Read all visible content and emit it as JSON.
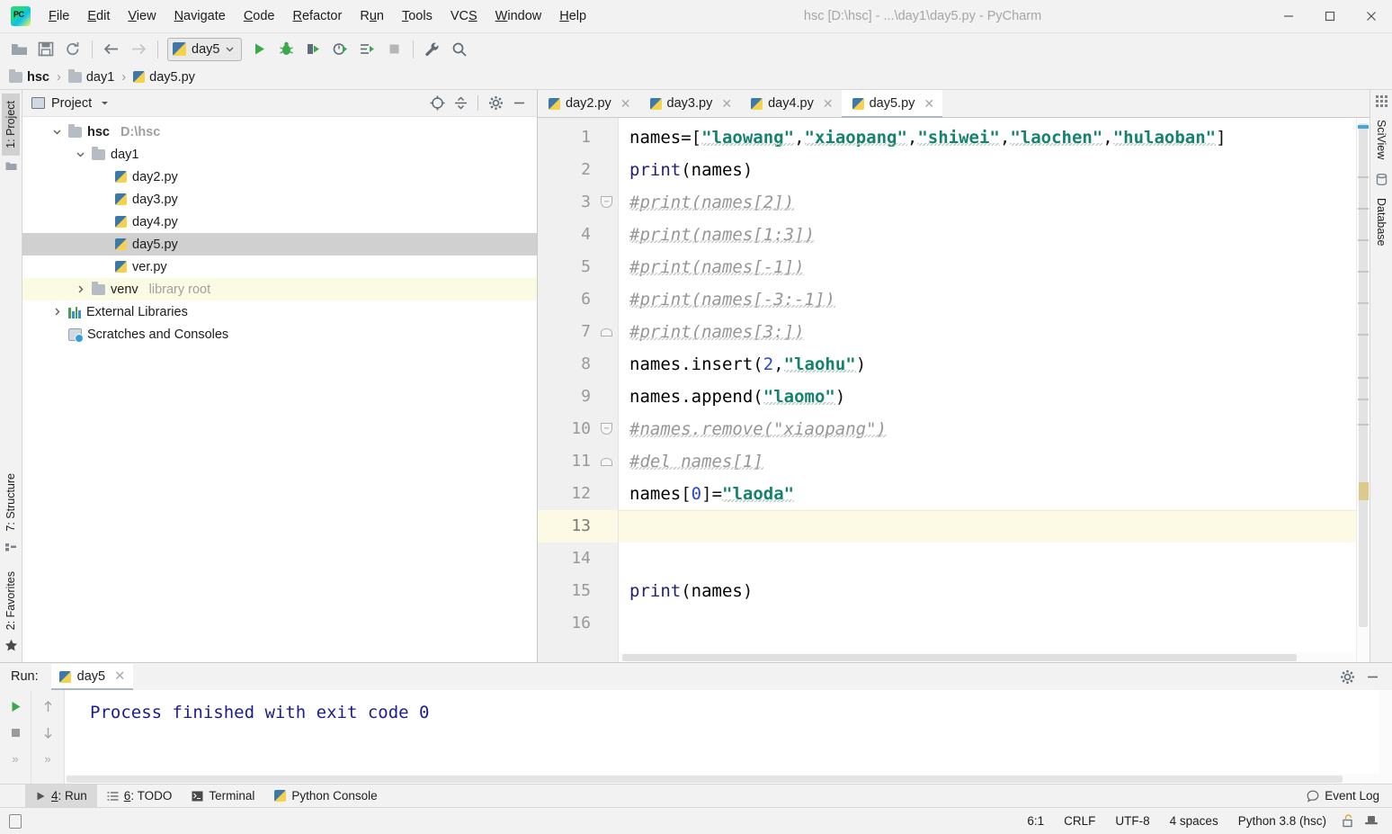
{
  "window": {
    "title": "hsc [D:\\hsc] - ...\\day1\\day5.py - PyCharm",
    "minimize": "—",
    "maximize": "▢",
    "close": "✕"
  },
  "menu": [
    {
      "label": "File"
    },
    {
      "label": "Edit"
    },
    {
      "label": "View"
    },
    {
      "label": "Navigate"
    },
    {
      "label": "Code"
    },
    {
      "label": "Refactor"
    },
    {
      "label": "Run"
    },
    {
      "label": "Tools"
    },
    {
      "label": "VCS"
    },
    {
      "label": "Window"
    },
    {
      "label": "Help"
    }
  ],
  "toolbar": {
    "open_icon": "open-folder-icon",
    "save_icon": "save-icon",
    "sync_icon": "refresh-icon",
    "back_icon": "back-arrow-icon",
    "forward_icon": "forward-arrow-icon",
    "run_config": "day5",
    "run_icon": "run-icon",
    "debug_icon": "debug-icon",
    "run_coverage_icon": "run-with-coverage-icon",
    "profile_icon": "profile-icon",
    "run_tests_icon": "run-tests-icon",
    "stop_icon": "stop-icon",
    "settings_icon": "wrench-icon",
    "search_icon": "search-icon"
  },
  "breadcrumb": [
    {
      "label": "hsc",
      "icon": "folder-icon",
      "bold": true
    },
    {
      "label": "day1",
      "icon": "folder-icon",
      "bold": false
    },
    {
      "label": "day5.py",
      "icon": "python-file-icon",
      "bold": false
    }
  ],
  "left_strip": {
    "project": "1: Project",
    "structure": "7: Structure",
    "favorites": "2: Favorites"
  },
  "right_strip": {
    "sciview": "SciView",
    "database": "Database"
  },
  "project_panel": {
    "title": "Project",
    "dropdown_icon": "chevron-down-icon",
    "locate_icon": "locate-file-icon",
    "collapse_icon": "collapse-all-icon",
    "settings_icon": "gear-icon",
    "hide_icon": "minimize-icon",
    "tree": [
      {
        "label": "hsc",
        "sub": "D:\\hsc",
        "indent": 0,
        "twisty": "expanded",
        "icon": "folder-icon",
        "bold": true,
        "state": "normal"
      },
      {
        "label": "day1",
        "sub": "",
        "indent": 1,
        "twisty": "expanded",
        "icon": "folder-icon",
        "bold": false,
        "state": "normal"
      },
      {
        "label": "day2.py",
        "sub": "",
        "indent": 2,
        "twisty": "none",
        "icon": "python-file-icon",
        "bold": false,
        "state": "normal"
      },
      {
        "label": "day3.py",
        "sub": "",
        "indent": 2,
        "twisty": "none",
        "icon": "python-file-icon",
        "bold": false,
        "state": "normal"
      },
      {
        "label": "day4.py",
        "sub": "",
        "indent": 2,
        "twisty": "none",
        "icon": "python-file-icon",
        "bold": false,
        "state": "normal"
      },
      {
        "label": "day5.py",
        "sub": "",
        "indent": 2,
        "twisty": "none",
        "icon": "python-file-icon",
        "bold": false,
        "state": "selected"
      },
      {
        "label": "ver.py",
        "sub": "",
        "indent": 2,
        "twisty": "none",
        "icon": "python-file-icon",
        "bold": false,
        "state": "normal"
      },
      {
        "label": "venv",
        "sub": "library root",
        "indent": 1,
        "twisty": "collapsed",
        "icon": "folder-icon",
        "bold": false,
        "state": "highlight"
      },
      {
        "label": "External Libraries",
        "sub": "",
        "indent": 0,
        "twisty": "collapsed",
        "icon": "libraries-icon",
        "bold": false,
        "state": "normal"
      },
      {
        "label": "Scratches and Consoles",
        "sub": "",
        "indent": 0,
        "twisty": "none",
        "icon": "scratches-icon",
        "bold": false,
        "state": "normal"
      }
    ]
  },
  "editor": {
    "tabs": [
      {
        "label": "day2.py",
        "active": false,
        "icon": "python-file-icon",
        "close": "✕"
      },
      {
        "label": "day3.py",
        "active": false,
        "icon": "python-file-icon",
        "close": "✕"
      },
      {
        "label": "day4.py",
        "active": false,
        "icon": "python-file-icon",
        "close": "✕"
      },
      {
        "label": "day5.py",
        "active": true,
        "icon": "python-file-icon",
        "close": "✕"
      }
    ],
    "line_numbers": [
      "1",
      "2",
      "3",
      "4",
      "5",
      "6",
      "7",
      "8",
      "9",
      "10",
      "11",
      "12",
      "13",
      "14",
      "15",
      "16"
    ],
    "current_line": 13,
    "lines": [
      {
        "n": 1,
        "text": "names=[\"laowang\",\"xiaopang\",\"shiwei\",\"laochen\",\"hulaoban\"]"
      },
      {
        "n": 2,
        "text": "print(names)"
      },
      {
        "n": 3,
        "text": "#print(names[2])"
      },
      {
        "n": 4,
        "text": "#print(names[1:3])"
      },
      {
        "n": 5,
        "text": "#print(names[-1])"
      },
      {
        "n": 6,
        "text": "#print(names[-3:-1])"
      },
      {
        "n": 7,
        "text": "#print(names[3:])"
      },
      {
        "n": 8,
        "text": "names.insert(2,\"laohu\")"
      },
      {
        "n": 9,
        "text": "names.append(\"laomo\")"
      },
      {
        "n": 10,
        "text": "#names.remove(\"xiaopang\")"
      },
      {
        "n": 11,
        "text": "#del names[1]"
      },
      {
        "n": 12,
        "text": "names[0]=\"laoda\""
      },
      {
        "n": 13,
        "text": ""
      },
      {
        "n": 14,
        "text": ""
      },
      {
        "n": 15,
        "text": "print(names)"
      },
      {
        "n": 16,
        "text": ""
      }
    ]
  },
  "run_panel": {
    "label": "Run:",
    "tab_label": "day5",
    "tab_icon": "python-file-icon",
    "tab_close": "✕",
    "settings_icon": "gear-icon",
    "hide_icon": "minimize-icon",
    "rerun_icon": "run-icon",
    "stop_icon": "stop-icon",
    "up_icon": "arrow-up-icon",
    "down_icon": "arrow-down-icon",
    "more_icon": "more-icon",
    "output": "Process finished with exit code 0"
  },
  "bottom_bar": {
    "items": [
      {
        "label": "4: Run",
        "icon": "run-icon",
        "active": true
      },
      {
        "label": "6: TODO",
        "icon": "todo-icon",
        "active": false
      },
      {
        "label": "Terminal",
        "icon": "terminal-icon",
        "active": false
      },
      {
        "label": "Python Console",
        "icon": "python-console-icon",
        "active": false
      }
    ],
    "event_log": "Event Log",
    "event_log_icon": "event-log-icon"
  },
  "status_bar": {
    "doc_icon": "document-icon",
    "position": "6:1",
    "line_separator": "CRLF",
    "encoding": "UTF-8",
    "indent": "4 spaces",
    "interpreter": "Python 3.8 (hsc)",
    "lock_icon": "unlocked-icon",
    "inspection_icon": "hector-hat-icon"
  },
  "colors": {
    "accent": "#2b43d6",
    "string": "#13836f",
    "comment": "#969696",
    "function": "#23216e",
    "console_text": "#1c1c8c",
    "current_line_bg": "#fcfae4",
    "selection_bg": "#d0d0d0",
    "highlight_bg": "#fbfbe4"
  }
}
